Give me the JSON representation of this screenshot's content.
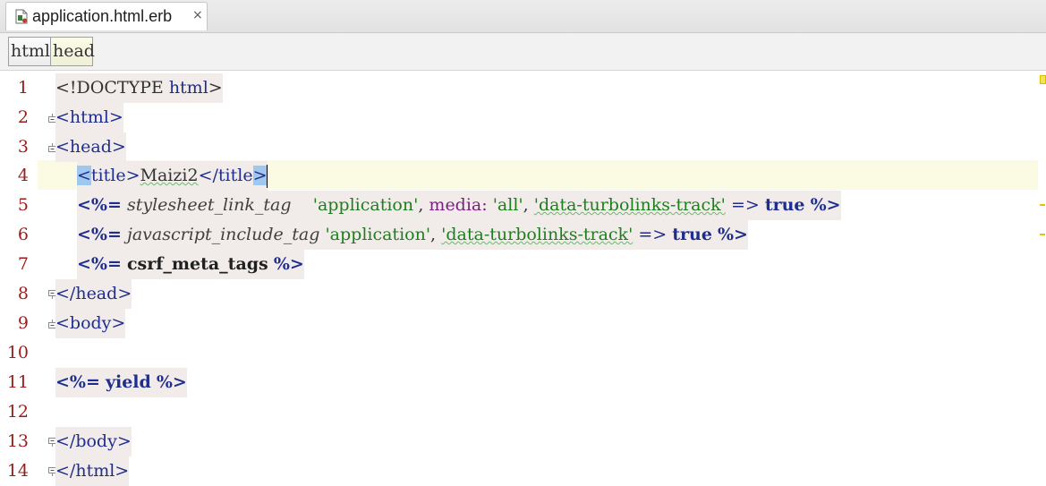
{
  "tab": {
    "filename": "application.html.erb",
    "close_glyph": "×",
    "file_icon": "erb-file-icon"
  },
  "breadcrumbs": [
    "html",
    "head"
  ],
  "editor": {
    "current_line": 4,
    "line_numbers": [
      "1",
      "2",
      "3",
      "4",
      "5",
      "6",
      "7",
      "8",
      "9",
      "10",
      "11",
      "12",
      "13",
      "14"
    ],
    "lines": {
      "l1": {
        "open": "<!DOCTYPE ",
        "name": "html",
        "close": ">"
      },
      "l2": {
        "open": "<",
        "name": "html",
        "close": ">"
      },
      "l3": {
        "open": "<",
        "name": "head",
        "close": ">"
      },
      "l4": {
        "open": "<",
        "name": "title",
        "mid": ">",
        "text": "Maizi2",
        "open2": "</",
        "name2": "title",
        "close": ">"
      },
      "l5": {
        "erb_open": "<%=",
        "method": "stylesheet_link_tag",
        "s1": "'application'",
        "comma1": ",",
        "sym": "media:",
        "s2": "'all'",
        "comma2": ",",
        "s3": "'data-turbolinks-track'",
        "arrow": "=>",
        "kw": "true",
        "erb_close": "%>"
      },
      "l6": {
        "erb_open": "<%=",
        "method": "javascript_include_tag",
        "s1": "'application'",
        "comma1": ",",
        "s2": "'data-turbolinks-track'",
        "arrow": "=>",
        "kw": "true",
        "erb_close": "%>"
      },
      "l7": {
        "erb_open": "<%=",
        "method": "csrf_meta_tags",
        "erb_close": "%>"
      },
      "l8": {
        "open": "</",
        "name": "head",
        "close": ">"
      },
      "l9": {
        "open": "<",
        "name": "body",
        "close": ">"
      },
      "l11": {
        "erb_open": "<%=",
        "method": "yield",
        "erb_close": "%>"
      },
      "l13": {
        "open": "</",
        "name": "body",
        "close": ">"
      },
      "l14": {
        "open": "</",
        "name": "html",
        "close": ">"
      }
    }
  },
  "colors": {
    "line_number": "#9c1b1b",
    "tag": "#1f2d8c",
    "string": "#1e7e1e",
    "symbol": "#7a2080",
    "current_line_bg": "#fbfbe3",
    "erb_bg": "#f1ecea"
  }
}
